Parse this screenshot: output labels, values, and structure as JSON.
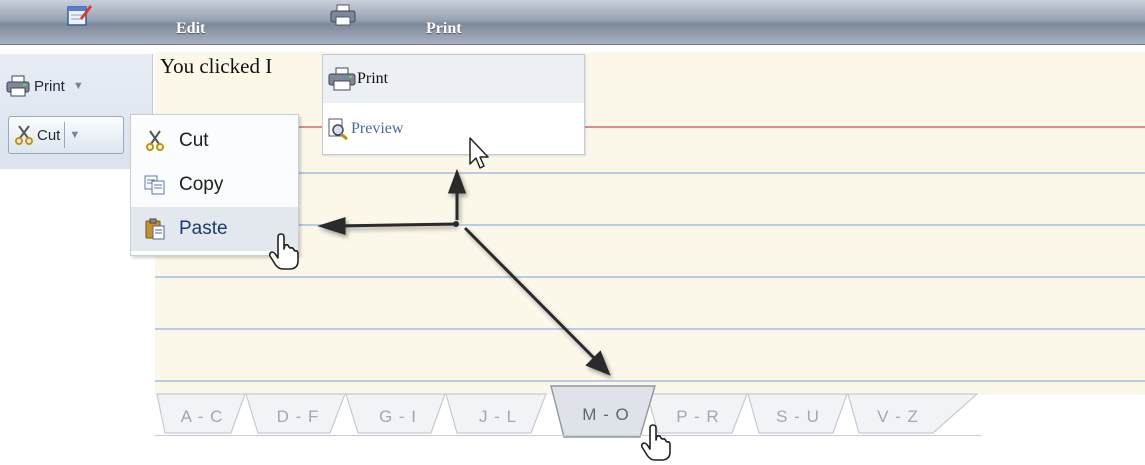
{
  "topbar": {
    "edit_label": "Edit",
    "print_label": "Print",
    "icons": [
      "notepad-pencil-icon",
      "printer-icon"
    ]
  },
  "toolbar": {
    "print_button_label": "Print",
    "cut_button_label": "Cut"
  },
  "paper": {
    "message": "You clicked I"
  },
  "context_menu": {
    "items": [
      {
        "label": "Cut",
        "icon": "scissors-icon"
      },
      {
        "label": "Copy",
        "icon": "copy-icon"
      },
      {
        "label": "Paste",
        "icon": "clipboard-paste-icon",
        "hovered": true
      }
    ]
  },
  "print_menu": {
    "items": [
      {
        "label": "Print",
        "icon": "printer-icon"
      },
      {
        "label": "Preview",
        "icon": "magnifier-page-icon"
      }
    ]
  },
  "tabs": {
    "items": [
      "A - C",
      "D - F",
      "G - I",
      "J - L",
      "M - O",
      "P - R",
      "S - U",
      "V - Z"
    ],
    "active": "M - O"
  },
  "colors": {
    "topbar": "#8f9aab",
    "paper": "#fbf8ea",
    "blue_rule": "#a9c6e4",
    "red_rule": "#e48a8e",
    "highlight": "#e3e8ef"
  }
}
